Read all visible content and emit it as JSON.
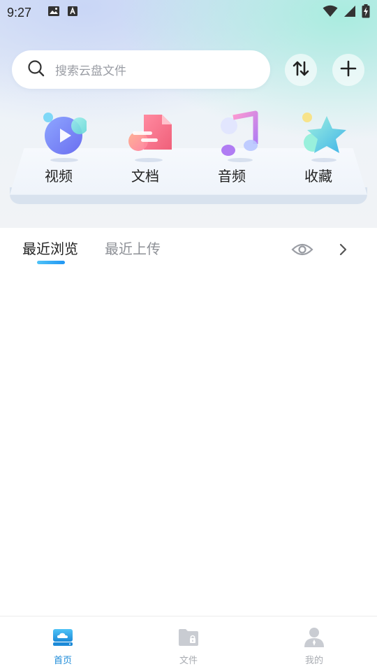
{
  "status_bar": {
    "time": "9:27",
    "left_icons": [
      "image-icon",
      "text-a-icon"
    ],
    "right_icons": [
      "wifi-icon",
      "signal-icon",
      "battery-charging-icon"
    ]
  },
  "search": {
    "placeholder": "搜索云盘文件",
    "icon": "search-icon"
  },
  "header_actions": [
    {
      "name": "transfer-sort",
      "icon": "up-down-arrows-icon"
    },
    {
      "name": "add",
      "icon": "plus-icon"
    }
  ],
  "categories": [
    {
      "label": "视频",
      "icon": "video-play-icon"
    },
    {
      "label": "文档",
      "icon": "document-icon"
    },
    {
      "label": "音频",
      "icon": "music-note-icon"
    },
    {
      "label": "收藏",
      "icon": "star-icon"
    }
  ],
  "tabs": [
    {
      "label": "最近浏览",
      "active": true
    },
    {
      "label": "最近上传",
      "active": false
    }
  ],
  "tab_actions": {
    "eye_icon": "eye-icon",
    "more_icon": "chevron-right-icon"
  },
  "bottom_nav": [
    {
      "label": "首页",
      "icon": "cloud-drive-icon",
      "active": true
    },
    {
      "label": "文件",
      "icon": "folder-lock-icon",
      "active": false
    },
    {
      "label": "我的",
      "icon": "user-icon",
      "active": false
    }
  ],
  "colors": {
    "accent": "#1c8ad8",
    "inactive": "#a9acb2",
    "tab_indicator": "#2196f3"
  }
}
